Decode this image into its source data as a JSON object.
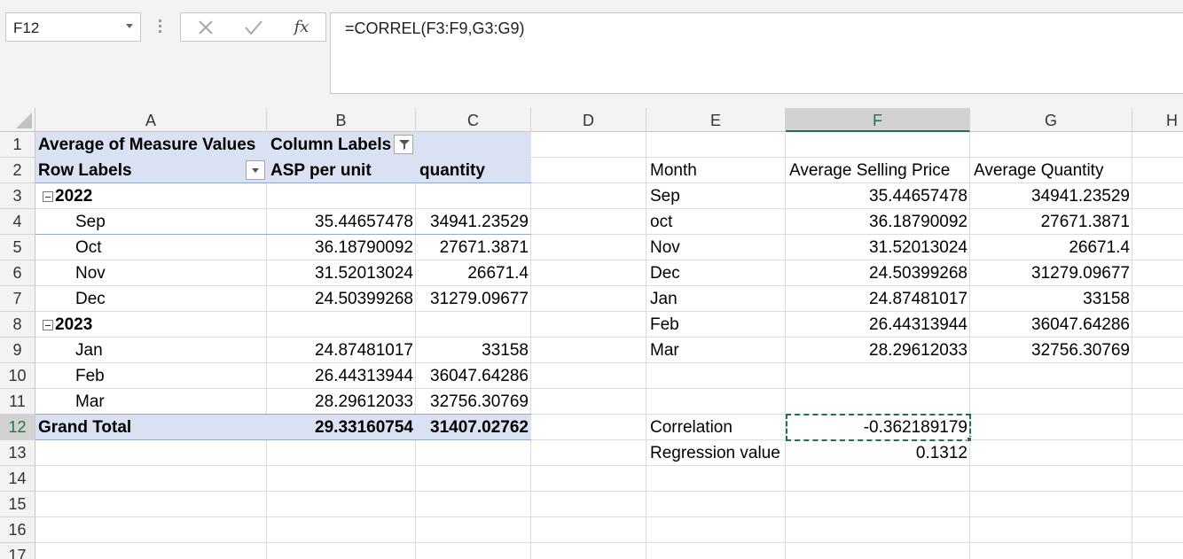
{
  "name_box": {
    "value": "F12"
  },
  "formula_bar": {
    "fx_label": "fx",
    "formula": "=CORREL(F3:F9,G3:G9)"
  },
  "columns": [
    "A",
    "B",
    "C",
    "D",
    "E",
    "F",
    "G",
    "H"
  ],
  "selected_column": "F",
  "rows": [
    "1",
    "2",
    "3",
    "4",
    "5",
    "6",
    "7",
    "8",
    "9",
    "10",
    "11",
    "12",
    "13",
    "14",
    "15",
    "16",
    "17"
  ],
  "selected_row": "12",
  "pivot": {
    "header_a1": "Average of Measure Values",
    "header_b1": "Column Labels",
    "row_labels": "Row Labels",
    "col_b": "ASP per unit",
    "col_c": "quantity",
    "year_2022": "2022",
    "year_2023": "2023",
    "data": [
      {
        "label": "Sep",
        "asp": "35.44657478",
        "qty": "34941.23529"
      },
      {
        "label": "Oct",
        "asp": "36.18790092",
        "qty": "27671.3871"
      },
      {
        "label": "Nov",
        "asp": "31.52013024",
        "qty": "26671.4"
      },
      {
        "label": "Dec",
        "asp": "24.50399268",
        "qty": "31279.09677"
      },
      {
        "label": "Jan",
        "asp": "24.87481017",
        "qty": "33158"
      },
      {
        "label": "Feb",
        "asp": "26.44313944",
        "qty": "36047.64286"
      },
      {
        "label": "Mar",
        "asp": "28.29612033",
        "qty": "32756.30769"
      }
    ],
    "grand_total_label": "Grand Total",
    "grand_total_asp": "29.33160754",
    "grand_total_qty": "31407.02762"
  },
  "table": {
    "header_month": "Month",
    "header_price": "Average Selling Price",
    "header_qty": "Average Quantity",
    "rows": [
      {
        "month": "Sep",
        "price": "35.44657478",
        "qty": "34941.23529"
      },
      {
        "month": "oct",
        "price": "36.18790092",
        "qty": "27671.3871"
      },
      {
        "month": "Nov",
        "price": "31.52013024",
        "qty": "26671.4"
      },
      {
        "month": "Dec",
        "price": "24.50399268",
        "qty": "31279.09677"
      },
      {
        "month": "Jan",
        "price": "24.87481017",
        "qty": "33158"
      },
      {
        "month": "Feb",
        "price": "26.44313944",
        "qty": "36047.64286"
      },
      {
        "month": "Mar",
        "price": "28.29612033",
        "qty": "32756.30769"
      }
    ],
    "correlation_label": "Correlation",
    "correlation_value": "-0.362189179",
    "regression_label": "Regression value",
    "regression_value": "0.1312"
  },
  "colors": {
    "accent": "#217346",
    "pivot_band": "#d9e1f2",
    "pivot_rule": "#8ea9db"
  }
}
